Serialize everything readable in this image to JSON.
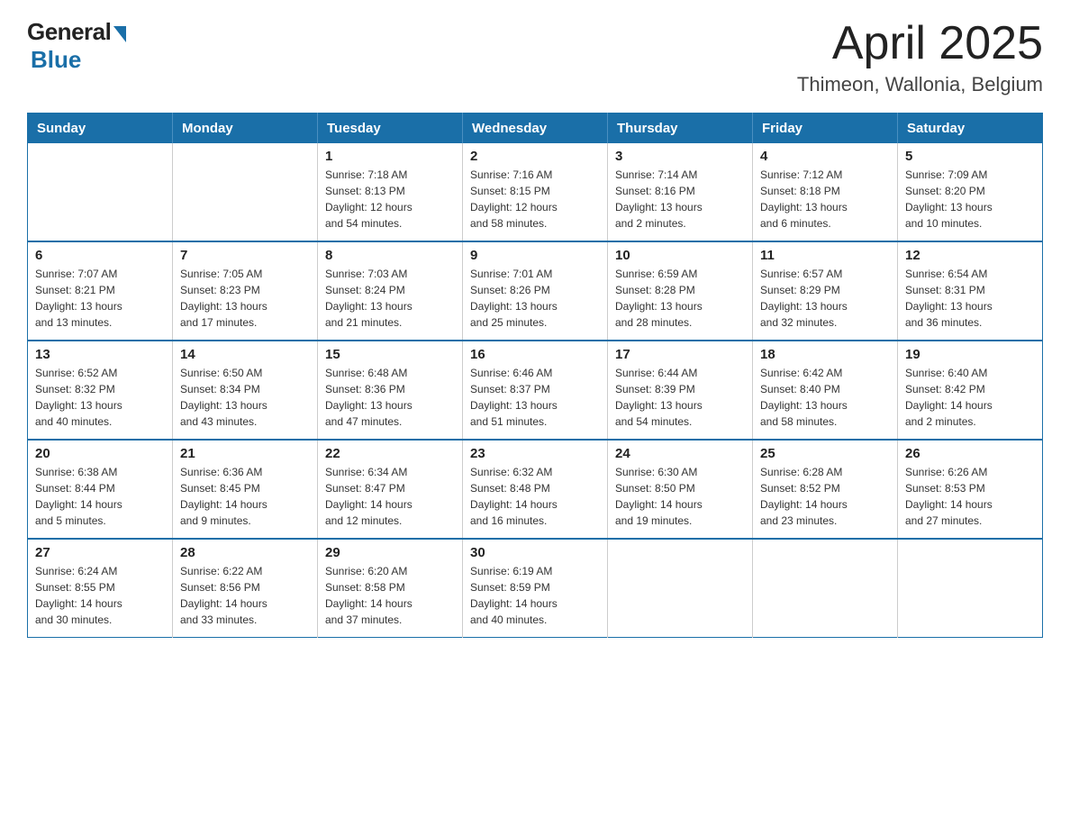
{
  "header": {
    "logo": {
      "general": "General",
      "blue": "Blue"
    },
    "title": "April 2025",
    "location": "Thimeon, Wallonia, Belgium"
  },
  "calendar": {
    "days_of_week": [
      "Sunday",
      "Monday",
      "Tuesday",
      "Wednesday",
      "Thursday",
      "Friday",
      "Saturday"
    ],
    "weeks": [
      [
        {
          "day": "",
          "info": ""
        },
        {
          "day": "",
          "info": ""
        },
        {
          "day": "1",
          "info": "Sunrise: 7:18 AM\nSunset: 8:13 PM\nDaylight: 12 hours\nand 54 minutes."
        },
        {
          "day": "2",
          "info": "Sunrise: 7:16 AM\nSunset: 8:15 PM\nDaylight: 12 hours\nand 58 minutes."
        },
        {
          "day": "3",
          "info": "Sunrise: 7:14 AM\nSunset: 8:16 PM\nDaylight: 13 hours\nand 2 minutes."
        },
        {
          "day": "4",
          "info": "Sunrise: 7:12 AM\nSunset: 8:18 PM\nDaylight: 13 hours\nand 6 minutes."
        },
        {
          "day": "5",
          "info": "Sunrise: 7:09 AM\nSunset: 8:20 PM\nDaylight: 13 hours\nand 10 minutes."
        }
      ],
      [
        {
          "day": "6",
          "info": "Sunrise: 7:07 AM\nSunset: 8:21 PM\nDaylight: 13 hours\nand 13 minutes."
        },
        {
          "day": "7",
          "info": "Sunrise: 7:05 AM\nSunset: 8:23 PM\nDaylight: 13 hours\nand 17 minutes."
        },
        {
          "day": "8",
          "info": "Sunrise: 7:03 AM\nSunset: 8:24 PM\nDaylight: 13 hours\nand 21 minutes."
        },
        {
          "day": "9",
          "info": "Sunrise: 7:01 AM\nSunset: 8:26 PM\nDaylight: 13 hours\nand 25 minutes."
        },
        {
          "day": "10",
          "info": "Sunrise: 6:59 AM\nSunset: 8:28 PM\nDaylight: 13 hours\nand 28 minutes."
        },
        {
          "day": "11",
          "info": "Sunrise: 6:57 AM\nSunset: 8:29 PM\nDaylight: 13 hours\nand 32 minutes."
        },
        {
          "day": "12",
          "info": "Sunrise: 6:54 AM\nSunset: 8:31 PM\nDaylight: 13 hours\nand 36 minutes."
        }
      ],
      [
        {
          "day": "13",
          "info": "Sunrise: 6:52 AM\nSunset: 8:32 PM\nDaylight: 13 hours\nand 40 minutes."
        },
        {
          "day": "14",
          "info": "Sunrise: 6:50 AM\nSunset: 8:34 PM\nDaylight: 13 hours\nand 43 minutes."
        },
        {
          "day": "15",
          "info": "Sunrise: 6:48 AM\nSunset: 8:36 PM\nDaylight: 13 hours\nand 47 minutes."
        },
        {
          "day": "16",
          "info": "Sunrise: 6:46 AM\nSunset: 8:37 PM\nDaylight: 13 hours\nand 51 minutes."
        },
        {
          "day": "17",
          "info": "Sunrise: 6:44 AM\nSunset: 8:39 PM\nDaylight: 13 hours\nand 54 minutes."
        },
        {
          "day": "18",
          "info": "Sunrise: 6:42 AM\nSunset: 8:40 PM\nDaylight: 13 hours\nand 58 minutes."
        },
        {
          "day": "19",
          "info": "Sunrise: 6:40 AM\nSunset: 8:42 PM\nDaylight: 14 hours\nand 2 minutes."
        }
      ],
      [
        {
          "day": "20",
          "info": "Sunrise: 6:38 AM\nSunset: 8:44 PM\nDaylight: 14 hours\nand 5 minutes."
        },
        {
          "day": "21",
          "info": "Sunrise: 6:36 AM\nSunset: 8:45 PM\nDaylight: 14 hours\nand 9 minutes."
        },
        {
          "day": "22",
          "info": "Sunrise: 6:34 AM\nSunset: 8:47 PM\nDaylight: 14 hours\nand 12 minutes."
        },
        {
          "day": "23",
          "info": "Sunrise: 6:32 AM\nSunset: 8:48 PM\nDaylight: 14 hours\nand 16 minutes."
        },
        {
          "day": "24",
          "info": "Sunrise: 6:30 AM\nSunset: 8:50 PM\nDaylight: 14 hours\nand 19 minutes."
        },
        {
          "day": "25",
          "info": "Sunrise: 6:28 AM\nSunset: 8:52 PM\nDaylight: 14 hours\nand 23 minutes."
        },
        {
          "day": "26",
          "info": "Sunrise: 6:26 AM\nSunset: 8:53 PM\nDaylight: 14 hours\nand 27 minutes."
        }
      ],
      [
        {
          "day": "27",
          "info": "Sunrise: 6:24 AM\nSunset: 8:55 PM\nDaylight: 14 hours\nand 30 minutes."
        },
        {
          "day": "28",
          "info": "Sunrise: 6:22 AM\nSunset: 8:56 PM\nDaylight: 14 hours\nand 33 minutes."
        },
        {
          "day": "29",
          "info": "Sunrise: 6:20 AM\nSunset: 8:58 PM\nDaylight: 14 hours\nand 37 minutes."
        },
        {
          "day": "30",
          "info": "Sunrise: 6:19 AM\nSunset: 8:59 PM\nDaylight: 14 hours\nand 40 minutes."
        },
        {
          "day": "",
          "info": ""
        },
        {
          "day": "",
          "info": ""
        },
        {
          "day": "",
          "info": ""
        }
      ]
    ]
  }
}
